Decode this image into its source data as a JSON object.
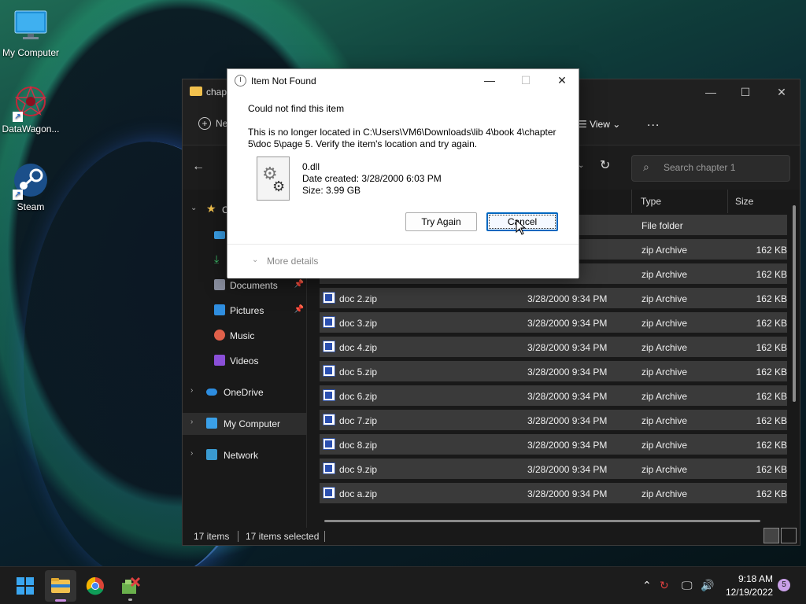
{
  "desktop": {
    "icons": [
      {
        "label": "My Computer",
        "icon": "monitor-icon"
      },
      {
        "label": "DataWagon...",
        "icon": "datawagon-icon"
      },
      {
        "label": "Steam",
        "icon": "steam-icon"
      }
    ]
  },
  "explorer": {
    "title": "chapt",
    "toolbar": {
      "new_label": "Ne",
      "view_label": "View",
      "more_label": "..."
    },
    "search_placeholder": "Search chapter 1",
    "nav": {
      "quick_access_label": "C",
      "items": [
        {
          "label": "Documents",
          "icon": "documents-icon",
          "pinned": true
        },
        {
          "label": "Pictures",
          "icon": "pictures-icon",
          "pinned": true
        },
        {
          "label": "Music",
          "icon": "music-icon",
          "pinned": false
        },
        {
          "label": "Videos",
          "icon": "videos-icon",
          "pinned": false
        },
        {
          "label": "OneDrive",
          "icon": "onedrive-icon"
        },
        {
          "label": "My Computer",
          "icon": "computer-icon"
        },
        {
          "label": "Network",
          "icon": "network-icon"
        }
      ]
    },
    "columns": {
      "date": "ed",
      "type": "Type",
      "size": "Size"
    },
    "rows": [
      {
        "name": "",
        "date": ":14 AM",
        "type": "File folder",
        "size": ""
      },
      {
        "name": "",
        "date": "34 PM",
        "type": "zip Archive",
        "size": "162 KB"
      },
      {
        "name": "",
        "date": "34 PM",
        "type": "zip Archive",
        "size": "162 KB"
      },
      {
        "name": "doc 2.zip",
        "date": "3/28/2000 9:34 PM",
        "type": "zip Archive",
        "size": "162 KB"
      },
      {
        "name": "doc 3.zip",
        "date": "3/28/2000 9:34 PM",
        "type": "zip Archive",
        "size": "162 KB"
      },
      {
        "name": "doc 4.zip",
        "date": "3/28/2000 9:34 PM",
        "type": "zip Archive",
        "size": "162 KB"
      },
      {
        "name": "doc 5.zip",
        "date": "3/28/2000 9:34 PM",
        "type": "zip Archive",
        "size": "162 KB"
      },
      {
        "name": "doc 6.zip",
        "date": "3/28/2000 9:34 PM",
        "type": "zip Archive",
        "size": "162 KB"
      },
      {
        "name": "doc 7.zip",
        "date": "3/28/2000 9:34 PM",
        "type": "zip Archive",
        "size": "162 KB"
      },
      {
        "name": "doc 8.zip",
        "date": "3/28/2000 9:34 PM",
        "type": "zip Archive",
        "size": "162 KB"
      },
      {
        "name": "doc 9.zip",
        "date": "3/28/2000 9:34 PM",
        "type": "zip Archive",
        "size": "162 KB"
      },
      {
        "name": "doc a.zip",
        "date": "3/28/2000 9:34 PM",
        "type": "zip Archive",
        "size": "162 KB"
      }
    ],
    "status": {
      "items": "17 items",
      "selected": "17 items selected"
    }
  },
  "dialog": {
    "title": "Item Not Found",
    "message": "Could not find this item",
    "detail": "This is no longer located in C:\\Users\\VM6\\Downloads\\lib 4\\book 4\\chapter 5\\doc 5\\page 5. Verify the item's location and try again.",
    "file_name": "0.dll",
    "date_created": "Date created: 3/28/2000 6:03 PM",
    "size": "Size: 3.99 GB",
    "try_again_label": "Try Again",
    "cancel_label": "Cancel",
    "more_details_label": "More details"
  },
  "taskbar": {
    "time": "9:18 AM",
    "date": "12/19/2022",
    "notification_count": "5"
  },
  "colors": {
    "accent": "#0067c0",
    "folder": "#f2c14e",
    "taskbar": "#1c1c1c"
  }
}
